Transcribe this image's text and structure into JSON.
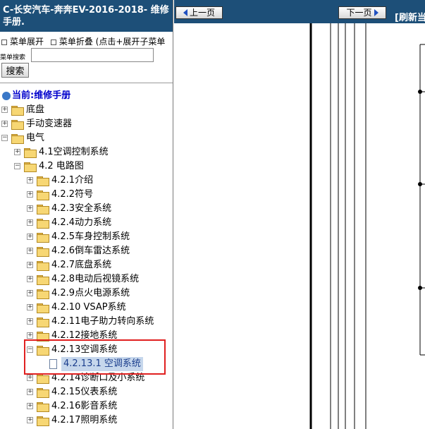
{
  "left": {
    "title": "C-长安汽车-奔奔EV-2016-2018- 维修手册.",
    "menu": {
      "expand": "菜单展开",
      "collapse": "菜单折叠 (点击+展开子菜单"
    },
    "search": {
      "label": "菜单搜索",
      "placeholder": "",
      "button": "搜索"
    },
    "tree": {
      "current": "当前:维修手册",
      "items": [
        {
          "label": "底盘"
        },
        {
          "label": "手动变速器"
        },
        {
          "label": "电气"
        },
        {
          "label": "4.1空调控制系统"
        },
        {
          "label": "4.2 电路图"
        },
        {
          "label": "4.2.1介绍"
        },
        {
          "label": "4.2.2符号"
        },
        {
          "label": "4.2.3安全系统"
        },
        {
          "label": "4.2.4动力系统"
        },
        {
          "label": "4.2.5车身控制系统"
        },
        {
          "label": "4.2.6倒车雷达系统"
        },
        {
          "label": "4.2.7底盘系统"
        },
        {
          "label": "4.2.8电动后视镜系统"
        },
        {
          "label": "4.2.9点火电源系统"
        },
        {
          "label": "4.2.10 VSAP系统"
        },
        {
          "label": "4.2.11电子助力转向系统"
        },
        {
          "label": "4.2.12接地系统"
        },
        {
          "label": "4.2.13空调系统"
        },
        {
          "label": "4.2.13.1 空调系统"
        },
        {
          "label": "4.2.14诊断口及小系统"
        },
        {
          "label": "4.2.15仪表系统"
        },
        {
          "label": "4.2.16影音系统"
        },
        {
          "label": "4.2.17照明系统"
        }
      ]
    }
  },
  "right": {
    "prev": "上一页",
    "next": "下一页",
    "refresh": "[刷新当"
  },
  "colors": {
    "header_bg": "#1d4f78",
    "highlight": "#e02020",
    "selected_bg": "#c6d7ec"
  }
}
